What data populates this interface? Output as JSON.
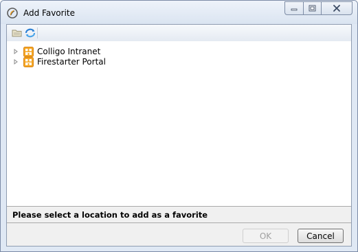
{
  "window": {
    "title": "Add Favorite",
    "controls": [
      "minimize-icon",
      "maximize-icon",
      "close-icon"
    ]
  },
  "toolbar": {
    "buttons": [
      {
        "icon": "folder-icon",
        "enabled": false
      },
      {
        "icon": "refresh-icon",
        "enabled": true
      }
    ]
  },
  "tree": {
    "items": [
      {
        "label": "Colligo Intranet",
        "icon": "sharepoint-site-icon",
        "expanded": false
      },
      {
        "label": "Firestarter Portal",
        "icon": "sharepoint-site-icon",
        "expanded": false
      }
    ]
  },
  "status": {
    "message": "Please select a location to add as a favorite"
  },
  "buttons": {
    "ok_label": "OK",
    "ok_enabled": false,
    "cancel_label": "Cancel"
  },
  "colors": {
    "site_icon": "#f5a623",
    "accent": "#2a7fd4"
  }
}
